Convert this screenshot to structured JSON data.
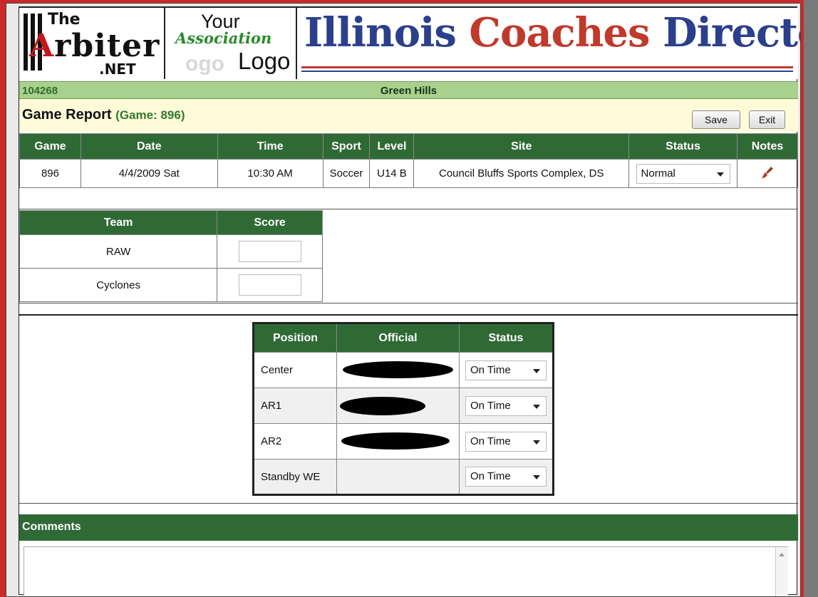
{
  "banner": {
    "arbiter_logo": {
      "the": "The",
      "word_red": "A",
      "word": "rbiter",
      "net": ".NET"
    },
    "assoc_logo": {
      "line1": "Your",
      "line2": "Association",
      "line3": "Logo",
      "ghost": "ogo"
    },
    "directory_logo": {
      "part1": "Illinois ",
      "part2": "Coaches",
      "part3": "Directory"
    }
  },
  "strip": {
    "id": "104268",
    "name": "Green Hills"
  },
  "title": {
    "label": "Game Report",
    "game": "(Game: 896)"
  },
  "toolbar": {
    "save_label": "Save",
    "exit_label": "Exit"
  },
  "game_table": {
    "headers": [
      "Game",
      "Date",
      "Time",
      "Sport",
      "Level",
      "Site",
      "Status",
      "Notes"
    ],
    "row": {
      "game": "896",
      "date": "4/4/2009 Sat",
      "time": "10:30 AM",
      "sport": "Soccer",
      "level": "U14 B",
      "site": "Council Bluffs Sports Complex, DS",
      "status": "Normal",
      "notes_icon": "paintbrush-icon"
    }
  },
  "team_table": {
    "headers": [
      "Team",
      "Score"
    ],
    "rows": [
      {
        "team": "RAW",
        "score": ""
      },
      {
        "team": "Cyclones",
        "score": ""
      }
    ]
  },
  "officials_table": {
    "headers": [
      "Position",
      "Official",
      "Status"
    ],
    "rows": [
      {
        "position": "Center",
        "status": "On Time"
      },
      {
        "position": "AR1",
        "status": "On Time"
      },
      {
        "position": "AR2",
        "status": "On Time"
      },
      {
        "position": "Standby WE",
        "status": "On Time"
      }
    ]
  },
  "comments": {
    "label": "Comments",
    "value": ""
  },
  "colors": {
    "header_green": "#2f6a35",
    "strip_green": "#a9d18e",
    "title_bg": "#fffbd8",
    "frame_red": "#cc2a2a"
  }
}
